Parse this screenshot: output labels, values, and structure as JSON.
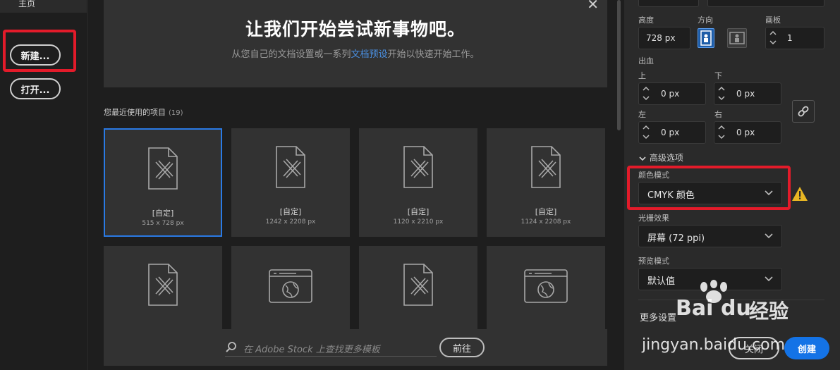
{
  "leftnav": {
    "home_label": "主页",
    "new_label": "新建...",
    "open_label": "打开..."
  },
  "hero": {
    "title": "让我们开始尝试新事物吧。",
    "subtitle_pre": "从您自己的文档设置或一系列",
    "subtitle_link": "文档预设",
    "subtitle_post": "开始以快速开始工作。"
  },
  "recent": {
    "label": "您最近使用的项目",
    "count": "(19)",
    "items": [
      {
        "name": "[自定]",
        "size": "515 x 728 px",
        "selected": true,
        "icon": "document-pencil-icon"
      },
      {
        "name": "[自定]",
        "size": "1242 x 2208 px",
        "icon": "document-pencil-icon"
      },
      {
        "name": "[自定]",
        "size": "1120 x 2210 px",
        "icon": "document-pencil-icon"
      },
      {
        "name": "[自定]",
        "size": "1124 x 2208 px",
        "icon": "document-pencil-icon"
      },
      {
        "name": "",
        "size": "",
        "icon": "document-pencil-icon"
      },
      {
        "name": "",
        "size": "",
        "icon": "browser-globe-icon"
      },
      {
        "name": "",
        "size": "",
        "icon": "document-pencil-icon"
      },
      {
        "name": "",
        "size": "",
        "icon": "browser-globe-icon"
      }
    ]
  },
  "stock": {
    "placeholder": "在 Adobe Stock 上查找更多模板",
    "go_label": "前往"
  },
  "panel": {
    "height_label": "高度",
    "height_value": "728 px",
    "orientation_label": "方向",
    "artboard_label": "画板",
    "artboard_value": "1",
    "bleed_label": "出血",
    "bleed": {
      "top_label": "上",
      "top_value": "0 px",
      "bottom_label": "下",
      "bottom_value": "0 px",
      "left_label": "左",
      "left_value": "0 px",
      "right_label": "右",
      "right_value": "0 px"
    },
    "advanced_label": "高级选项",
    "color_mode_label": "颜色模式",
    "color_mode_value": "CMYK 颜色",
    "raster_label": "光栅效果",
    "raster_value": "屏幕 (72 ppi)",
    "preview_label": "预览模式",
    "preview_value": "默认值",
    "more_settings": "更多设置",
    "close_label": "关闭",
    "create_label": "创建"
  },
  "watermark": {
    "brand": "Bai",
    "brand2": "经验",
    "url": "jingyan.baidu.com"
  },
  "colors": {
    "accent": "#1473e6",
    "highlight": "#e31b2a",
    "warning": "#e8b623"
  }
}
